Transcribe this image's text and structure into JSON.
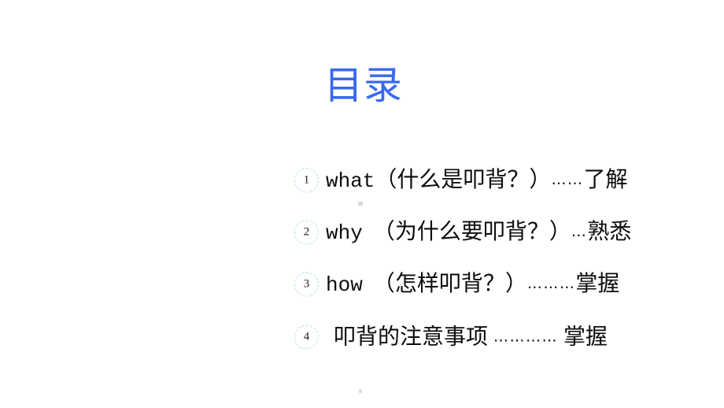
{
  "slide": {
    "title": "目录",
    "title_color": "#3a69ee",
    "background_color": "#ffffff",
    "text_color": "#0d0d0d",
    "badge_border_color": "#b4e2f2"
  },
  "toc": {
    "items": [
      {
        "number": "1",
        "latin": "what",
        "gap": "",
        "question": "（什么是叩背？）",
        "leader": "……",
        "level": "了解",
        "full_text": "what（什么是叩背？）……了解"
      },
      {
        "number": "2",
        "latin": "why",
        "gap": " ",
        "question": "（为什么要叩背？）",
        "leader": "…",
        "level": "熟悉",
        "full_text": "why （为什么要叩背？）…熟悉"
      },
      {
        "number": "3",
        "latin": "how",
        "gap": " ",
        "question": "（怎样叩背？）",
        "leader": "………",
        "level": "掌握",
        "full_text": "how （怎样叩背？）………掌握"
      },
      {
        "number": "4",
        "latin": "",
        "gap": "",
        "question": "叩背的注意事项",
        "leader": "…………",
        "level": "掌握",
        "full_text": "叩背的注意事项 ………… 掌握"
      }
    ]
  }
}
